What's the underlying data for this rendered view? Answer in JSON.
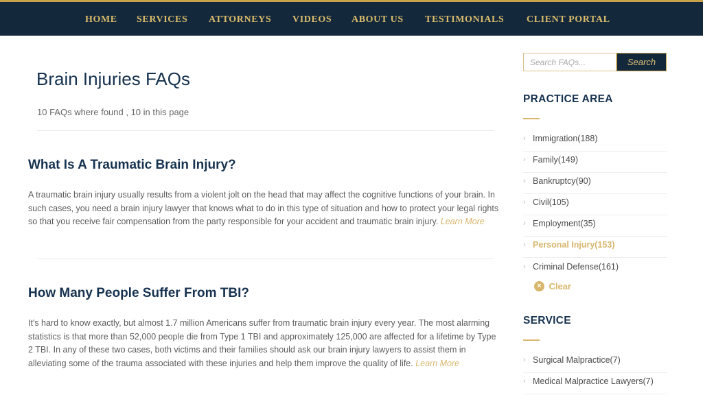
{
  "nav": {
    "items": [
      "HOME",
      "SERVICES",
      "ATTORNEYS",
      "VIDEOS",
      "ABOUT US",
      "TESTIMONIALS",
      "CLIENT PORTAL"
    ]
  },
  "main": {
    "title": "Brain Injuries FAQs",
    "count_text": "10 FAQs where found , 10 in this page",
    "faqs": [
      {
        "question": "What Is A Traumatic Brain Injury?",
        "answer": "A traumatic brain injury usually results from a violent jolt on the head that may affect the cognitive functions of your brain. In such cases, you need a brain injury lawyer that knows what to do in this type of situation and how to protect your legal rights so that you receive fair compensation from the party responsible for your accident and traumatic brain injury.",
        "learn_more": "Learn More"
      },
      {
        "question": "How Many People Suffer From TBI?",
        "answer": "It's hard to know exactly, but almost 1.7 million Americans suffer from traumatic brain injury every year. The most alarming statistics is that more than 52,000 people die from Type 1 TBI and approximately 125,000 are affected for a lifetime by Type 2 TBI. In any of these two cases, both victims and their families should ask our brain injury lawyers to assist them in alleviating some of the trauma associated with these injuries and help them improve the quality of life.",
        "learn_more": "Learn More"
      }
    ]
  },
  "sidebar": {
    "search_placeholder": "Search FAQs...",
    "search_button": "Search",
    "practice_heading": "PRACTICE AREA",
    "practice_items": [
      "Immigration(188)",
      "Family(149)",
      "Bankruptcy(90)",
      "Civil(105)",
      "Employment(35)",
      "Personal Injury(153)",
      "Criminal Defense(161)"
    ],
    "active_practice": "Personal Injury(153)",
    "clear_label": "Clear",
    "service_heading": "SERVICE",
    "service_items": [
      "Surgical Malpractice(7)",
      "Medical Malpractice Lawyers(7)"
    ]
  },
  "colors": {
    "nav_bg": "#14283c",
    "accent_gold": "#d8b66c",
    "heading_navy": "#16324f"
  }
}
